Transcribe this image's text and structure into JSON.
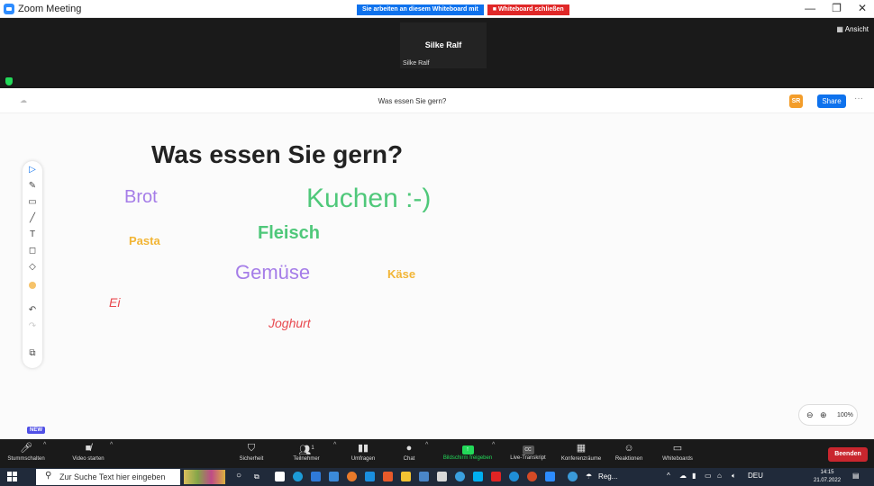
{
  "window": {
    "title": "Zoom Meeting",
    "banner_working": "Sie arbeiten an diesem Whiteboard mit",
    "banner_close": "Whiteboard schließen",
    "minimize": "—",
    "restore": "❐",
    "close": "✕"
  },
  "video": {
    "participant_name_large": "Silke Ralf",
    "participant_name_small": "Silke Ralf",
    "view_button": "Ansicht"
  },
  "whiteboard": {
    "title": "Was essen Sie gern?",
    "avatar_initials": "SR",
    "share_label": "Share",
    "more_label": "···",
    "words": {
      "heading": "Was essen Sie gern?",
      "brot": "Brot",
      "kuchen": "Kuchen :-)",
      "pasta": "Pasta",
      "fleisch": "Fleisch",
      "gemuese": "Gemüse",
      "kaese": "Käse",
      "ei": "Ei",
      "joghurt": "Joghurt"
    },
    "zoom_level": "100%",
    "new_badge": "NEW"
  },
  "controls": {
    "mute": "Stummschalten",
    "video": "Video starten",
    "security": "Sicherheit",
    "participants": "Teilnehmer",
    "participant_count": "1",
    "polls": "Umfragen",
    "chat": "Chat",
    "share_screen": "Bildschirm freigeben",
    "transcript": "Live-Transkript",
    "breakout": "Konferenzräume",
    "reactions": "Reaktionen",
    "whiteboards": "Whiteboards",
    "end": "Beenden"
  },
  "taskbar": {
    "search_placeholder": "Zur Suche Text hier eingeben",
    "weather_label": "Reg...",
    "language": "DEU",
    "time": "14:15",
    "date": "21.07.2022"
  },
  "colors": {
    "accent_blue": "#0e72ed",
    "end_red": "#c9262e",
    "green": "#23d959",
    "purple_text": "#a57de8",
    "green_text": "#4fc87a",
    "orange_text": "#f2b535",
    "red_text": "#e8494f"
  }
}
